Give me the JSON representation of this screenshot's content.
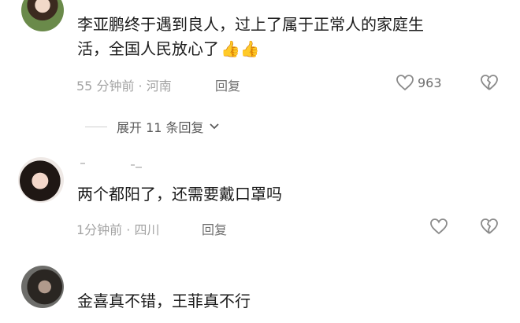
{
  "comments": [
    {
      "text_line1": "李亚鹏终于遇到良人，过上了属于正常人的家庭生",
      "text_line2": "活，全国人民放心了",
      "emoji": "👍👍",
      "meta": "55 分钟前 · 河南",
      "reply": "回复",
      "likes": "963"
    },
    {
      "text": "两个都阳了，还需要戴口罩吗",
      "meta": "1分钟前 · 四川",
      "reply": "回复"
    },
    {
      "text": "金喜真不错，王菲真不行"
    }
  ],
  "expand_replies": {
    "label": "展开 11 条回复"
  },
  "icons": {
    "like": "heart-outline-icon",
    "dislike": "broken-heart-icon",
    "expand": "chevron-down-icon"
  }
}
